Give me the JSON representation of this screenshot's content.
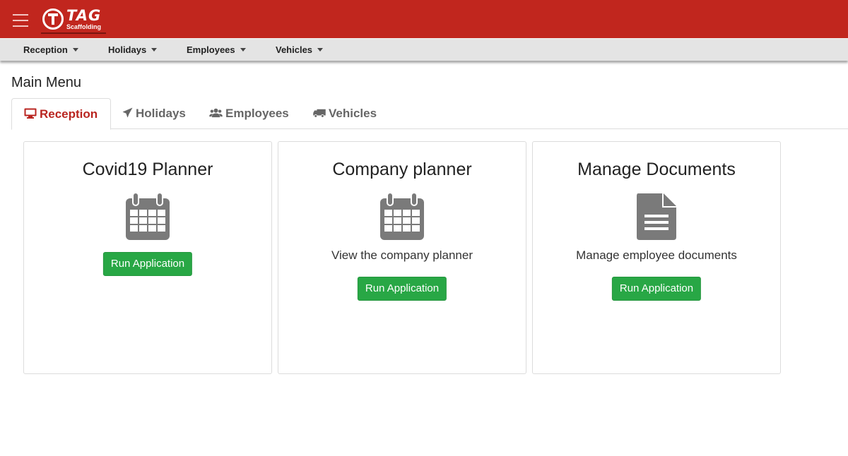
{
  "brand": {
    "name": "TAG",
    "tagline": "Scaffolding",
    "color": "#c1261e"
  },
  "navbar": {
    "items": [
      {
        "label": "Reception"
      },
      {
        "label": "Holidays"
      },
      {
        "label": "Employees"
      },
      {
        "label": "Vehicles"
      }
    ]
  },
  "page": {
    "title": "Main Menu"
  },
  "tabs": [
    {
      "label": "Reception",
      "icon": "monitor-icon",
      "active": true
    },
    {
      "label": "Holidays",
      "icon": "plane-icon",
      "active": false
    },
    {
      "label": "Employees",
      "icon": "users-icon",
      "active": false
    },
    {
      "label": "Vehicles",
      "icon": "truck-icon",
      "active": false
    }
  ],
  "cards": [
    {
      "title": "Covid19 Planner",
      "icon": "calendar-icon",
      "description": "",
      "button": "Run Application"
    },
    {
      "title": "Company planner",
      "icon": "calendar-icon",
      "description": "View the company planner",
      "button": "Run Application"
    },
    {
      "title": "Manage Documents",
      "icon": "document-icon",
      "description": "Manage employee documents",
      "button": "Run Application"
    }
  ],
  "colors": {
    "accent": "#b92520",
    "button": "#28a745",
    "icon": "#7a7a7a"
  }
}
